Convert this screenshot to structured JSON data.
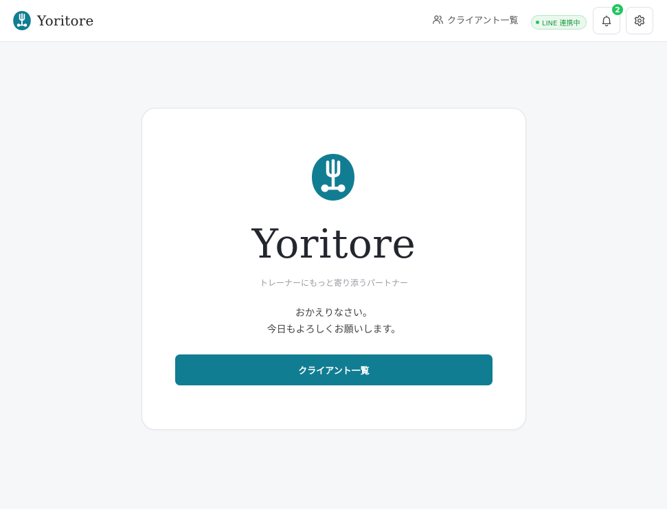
{
  "header": {
    "brand_name": "Yoritore",
    "brand_logo_icon": "fork-logo-icon",
    "nav_clients_label": "クライアント一覧",
    "nav_clients_icon": "users-icon",
    "line_status_label": "LINE 連携中",
    "notifications_count": "2",
    "notifications_icon": "bell-icon",
    "settings_icon": "gear-icon"
  },
  "card": {
    "title": "Yoritore",
    "tagline": "トレーナーにもっと寄り添うパートナー",
    "welcome_line1": "おかえりなさい。",
    "welcome_line2": "今日もよろしくお願いします。",
    "primary_button_label": "クライアント一覧"
  },
  "colors": {
    "brand": "#117d92",
    "line_green": "#22c55e",
    "background": "#f6f7f9"
  }
}
